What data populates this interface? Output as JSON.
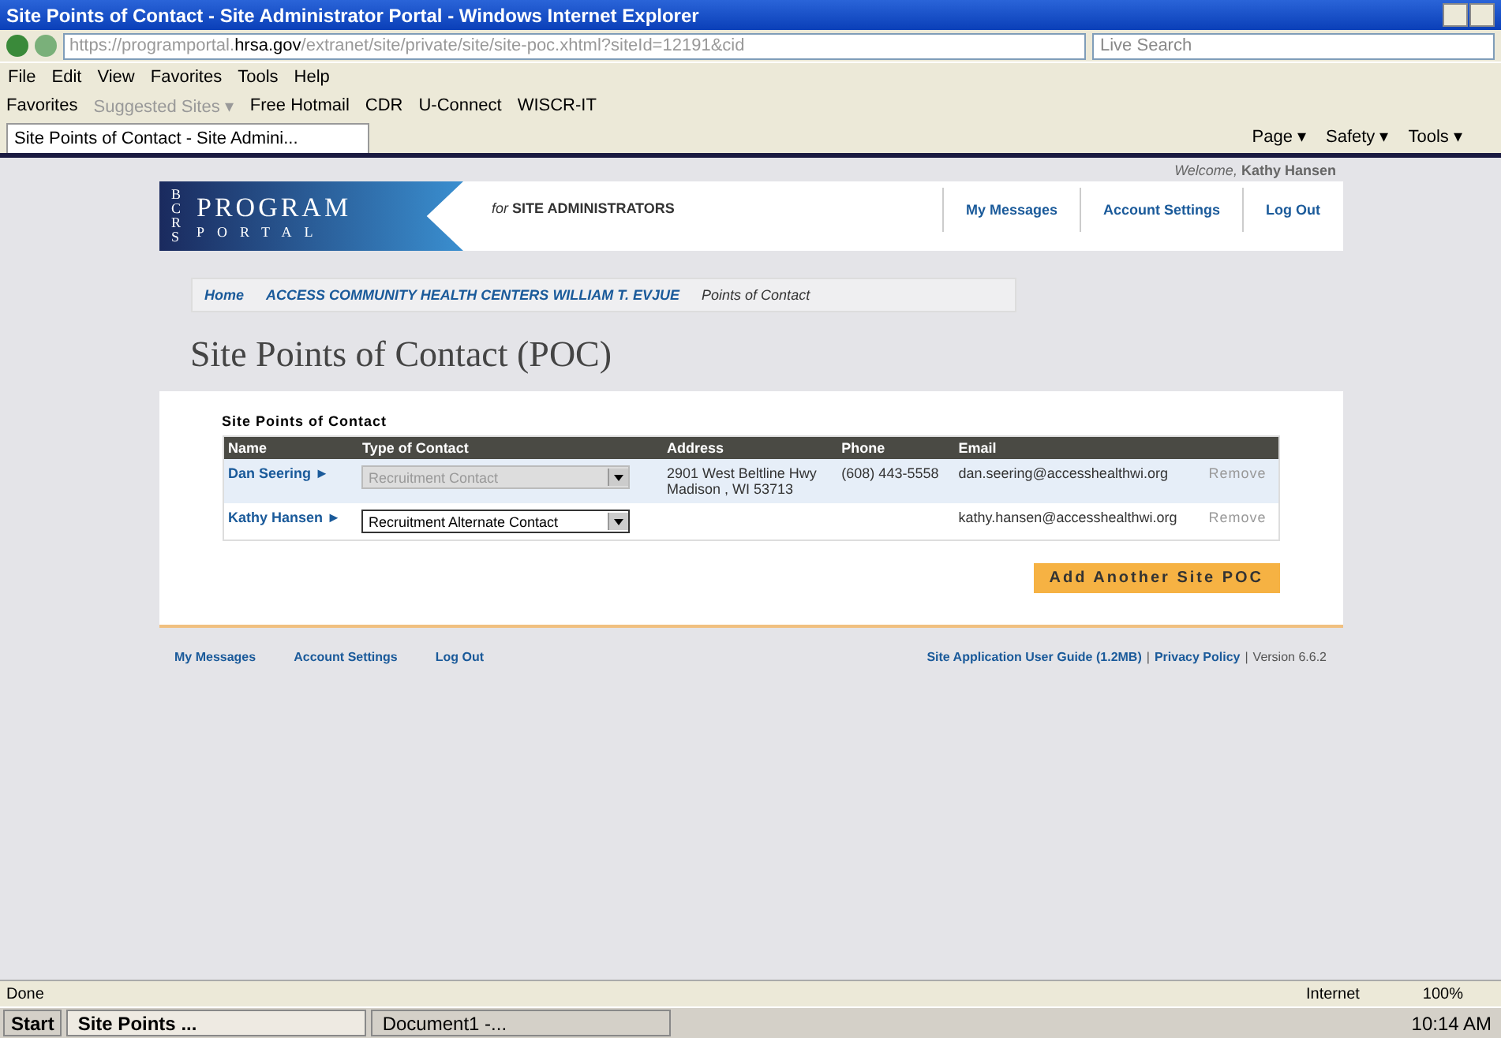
{
  "window": {
    "title": "Site Points of Contact - Site Administrator Portal - Windows Internet Explorer"
  },
  "address_bar": {
    "url_prefix": "https://programportal.",
    "url_domain": "hrsa.gov",
    "url_rest": "/extranet/site/private/site/site-poc.xhtml?siteId=12191&cid",
    "search_placeholder": "Live Search"
  },
  "menu": [
    "File",
    "Edit",
    "View",
    "Favorites",
    "Tools",
    "Help"
  ],
  "favorites_bar": {
    "label": "Favorites",
    "items": [
      {
        "label": "Suggested Sites ▾",
        "disabled": true
      },
      {
        "label": "Free Hotmail",
        "disabled": false
      },
      {
        "label": "CDR",
        "disabled": false
      },
      {
        "label": "U-Connect",
        "disabled": false
      },
      {
        "label": "WISCR-IT",
        "disabled": false
      }
    ]
  },
  "browser_tab": {
    "title": "Site Points of Contact - Site Admini..."
  },
  "command_bar": [
    "Page ▾",
    "Safety ▾",
    "Tools ▾"
  ],
  "portal": {
    "logo_side": "BCRS",
    "logo_top": "PROGRAM",
    "logo_bottom": "PORTAL",
    "for_prefix": "for",
    "for_label": "SITE ADMINISTRATORS",
    "welcome_prefix": "Welcome,",
    "welcome_name": "Kathy Hansen",
    "nav": [
      "My Messages",
      "Account Settings",
      "Log Out"
    ]
  },
  "breadcrumb": [
    "Home",
    "ACCESS COMMUNITY HEALTH CENTERS WILLIAM T. EVJUE",
    "Points of Contact"
  ],
  "page_title": "Site Points of Contact (POC)",
  "section_title": "Site Points of Contact",
  "table": {
    "columns": [
      "Name",
      "Type of Contact",
      "Address",
      "Phone",
      "Email"
    ],
    "rows": [
      {
        "name": "Dan Seering ►",
        "type": "Recruitment Contact",
        "type_disabled": true,
        "address": [
          "2901 West Beltline Hwy",
          "Madison , WI 53713"
        ],
        "phone": "(608) 443-5558",
        "email": "dan.seering@accesshealthwi.org",
        "action": "Remove"
      },
      {
        "name": "Kathy Hansen ►",
        "type": "Recruitment Alternate Contact",
        "type_disabled": false,
        "email": "kathy.hansen@accesshealthwi.org",
        "action": "Remove"
      }
    ]
  },
  "add_button": "Add Another Site POC",
  "footer": {
    "links": [
      "My Messages",
      "Account Settings",
      "Log Out"
    ],
    "right": [
      "Site Application User Guide (1.2MB)",
      "Privacy Policy"
    ],
    "separator": "|",
    "version": "Version 6.6.2"
  },
  "status_bar": {
    "text": "Done",
    "zone": "Internet",
    "zoom": "100%"
  },
  "taskbar": {
    "start": "Start",
    "items": [
      {
        "label": "Site Points ...",
        "selected": true
      },
      {
        "label": "Document1 -...",
        "selected": false
      }
    ],
    "clock": "10:14 AM"
  }
}
